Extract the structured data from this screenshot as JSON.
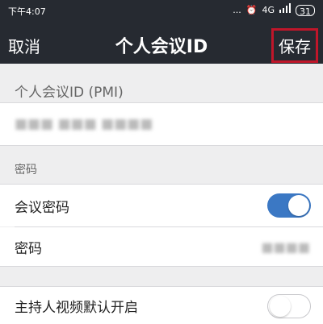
{
  "status_bar": {
    "time": "下午4:07",
    "icons": [
      "...",
      "⏰",
      "4G",
      "signal"
    ],
    "battery": "31"
  },
  "nav": {
    "cancel_label": "取消",
    "title": "个人会议ID",
    "save_label": "保存"
  },
  "pmi_section": {
    "title": "个人会议ID (PMI)",
    "value": "■■■ ■■■ ■■■■"
  },
  "password_section": {
    "title": "密码",
    "meeting_password_label": "会议密码",
    "meeting_password_enabled": true,
    "password_label": "密码",
    "password_value": "■■■■"
  },
  "video_section": {
    "host_video_label": "主持人视频默认开启",
    "host_video_enabled": false
  },
  "colors": {
    "header_bg": "#262a31",
    "save_border": "#c0162a",
    "toggle_on": "#3b78c4"
  }
}
